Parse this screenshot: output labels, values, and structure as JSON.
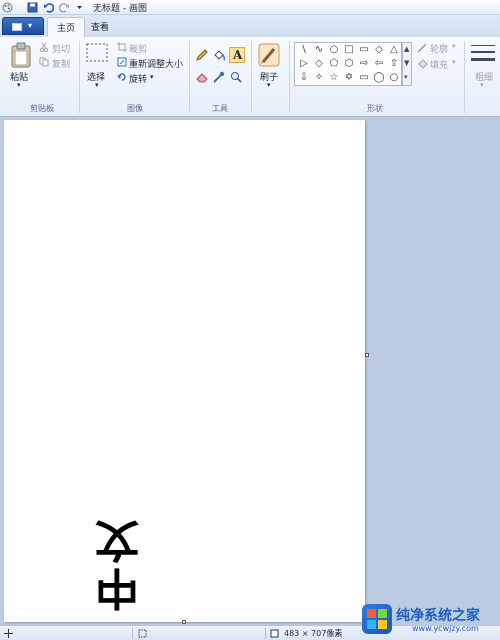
{
  "window": {
    "title": "无标题 - 画图"
  },
  "tabs": [
    {
      "label": "主页",
      "active": true
    },
    {
      "label": "查看",
      "active": false
    }
  ],
  "ribbon": {
    "clipboard": {
      "paste": "粘贴",
      "cut": "剪切",
      "copy": "复制",
      "group": "剪贴板"
    },
    "image": {
      "select": "选择",
      "crop": "裁剪",
      "resize": "重新调整大小",
      "rotate": "旋转",
      "group": "图像"
    },
    "tools": {
      "group": "工具"
    },
    "brushes": {
      "label": "刷子"
    },
    "shapes": {
      "outline": "轮廓",
      "fill": "填充",
      "group": "形状",
      "glyphs": [
        "\\",
        "∿",
        "○",
        "□",
        "▭",
        "◇",
        "△",
        "▷",
        "◇",
        "⬠",
        "⬡",
        "⇨",
        "⇦",
        "⇧",
        "⇩",
        "✧",
        "☆",
        "✡",
        "▭",
        "◯",
        "○"
      ]
    },
    "size": {
      "label": "粗细"
    }
  },
  "canvas": {
    "text": "中文"
  },
  "status": {
    "dimensions": "483 × 707像素"
  },
  "watermark": {
    "name": "纯净系统之家",
    "url": "www.ycwjzy.com"
  },
  "colors": {
    "accent": "#1b4e9f",
    "workspace": "#bccbe2"
  }
}
